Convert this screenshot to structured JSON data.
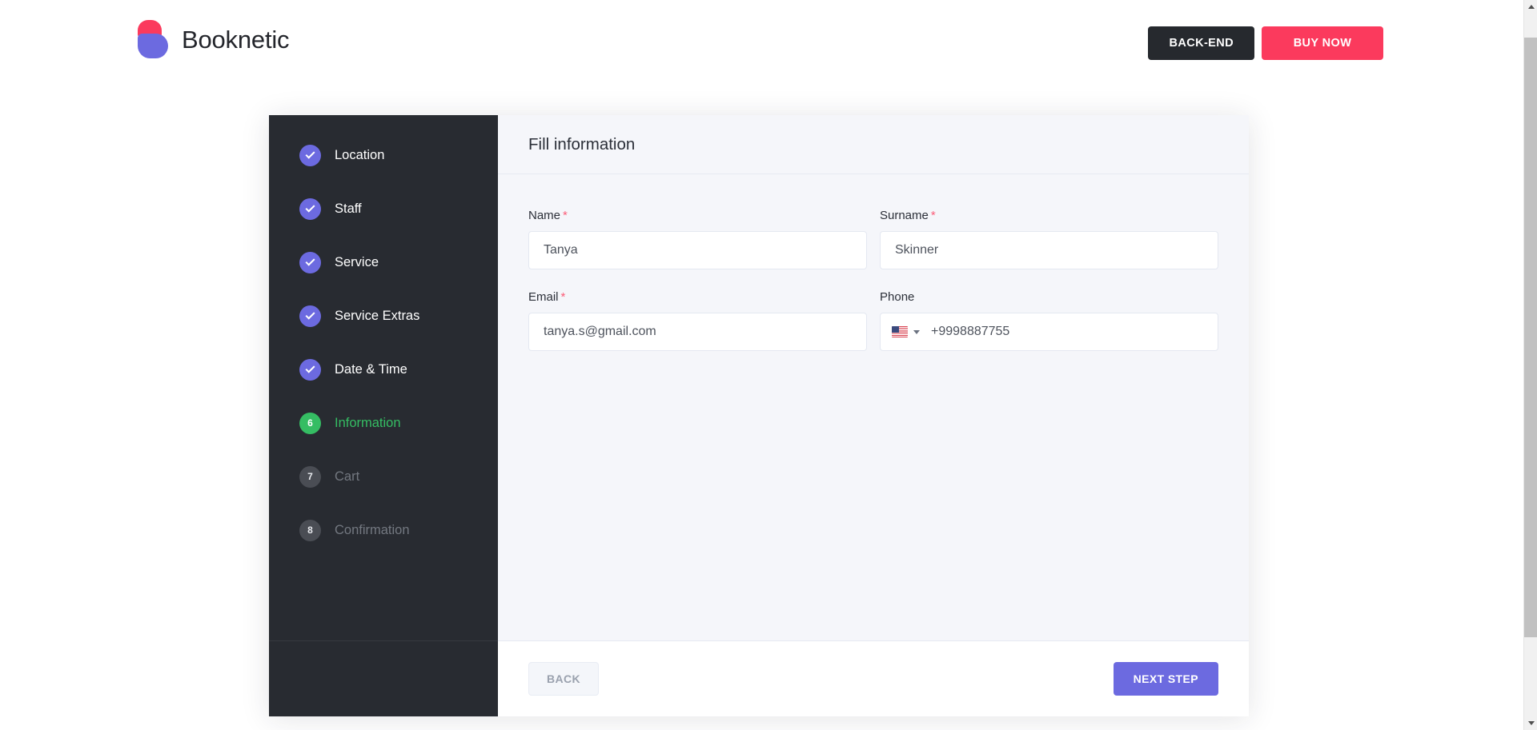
{
  "header": {
    "brand_name": "Booknetic",
    "logo_icon": "booknetic-logo-icon",
    "backend_label": "BACK-END",
    "buy_now_label": "BUY NOW",
    "colors": {
      "backend_bg": "#26292e",
      "buy_now_bg": "#fb3a5d",
      "logo_pink": "#fb3a5d",
      "logo_purple": "#6c6ae0"
    }
  },
  "sidebar": {
    "steps": [
      {
        "number": "1",
        "label": "Location",
        "state": "done",
        "badge_glyph": "check"
      },
      {
        "number": "2",
        "label": "Staff",
        "state": "done",
        "badge_glyph": "check"
      },
      {
        "number": "3",
        "label": "Service",
        "state": "done",
        "badge_glyph": "check"
      },
      {
        "number": "4",
        "label": "Service Extras",
        "state": "done",
        "badge_glyph": "check"
      },
      {
        "number": "5",
        "label": "Date & Time",
        "state": "done",
        "badge_glyph": "check"
      },
      {
        "number": "6",
        "label": "Information",
        "state": "active",
        "badge_glyph": "6"
      },
      {
        "number": "7",
        "label": "Cart",
        "state": "pending",
        "badge_glyph": "7"
      },
      {
        "number": "8",
        "label": "Confirmation",
        "state": "pending",
        "badge_glyph": "8"
      }
    ],
    "colors": {
      "background": "#282b31",
      "done_badge": "#6c6ae0",
      "active_badge": "#35bd63",
      "active_text": "#35bd63",
      "pending_badge": "#4a4d54",
      "pending_text": "#737880"
    }
  },
  "panel": {
    "title": "Fill information",
    "fields": {
      "name": {
        "label": "Name",
        "required_marker": "*",
        "value": "Tanya",
        "placeholder": "Name"
      },
      "surname": {
        "label": "Surname",
        "required_marker": "*",
        "value": "Skinner",
        "placeholder": "Surname"
      },
      "email": {
        "label": "Email",
        "required_marker": "*",
        "value": "tanya.s@gmail.com",
        "placeholder": "Email"
      },
      "phone": {
        "label": "Phone",
        "required_marker": "",
        "value": "+9998887755",
        "placeholder": "Phone",
        "country_flag": "us-flag-icon",
        "caret_icon": "chevron-down-icon"
      }
    }
  },
  "footer": {
    "back_label": "BACK",
    "next_label": "NEXT STEP",
    "colors": {
      "next_bg": "#6c6ae0",
      "back_bg": "#f4f6fa",
      "back_text": "#9aa1ae"
    }
  },
  "scrollbar": {
    "up_icon": "scroll-up-arrow-icon",
    "down_icon": "scroll-down-arrow-icon"
  }
}
